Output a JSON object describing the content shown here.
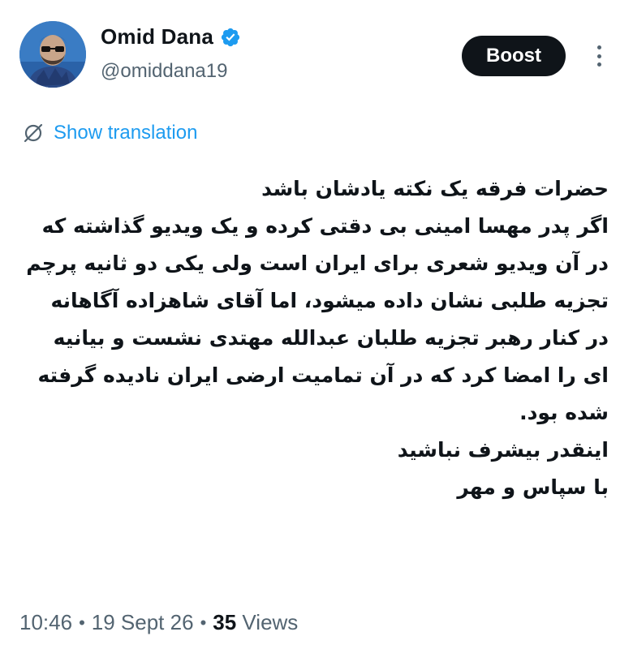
{
  "author": {
    "display_name": "Omid Dana",
    "handle": "@omiddana19",
    "verified": true,
    "verified_color": "#1d9bf0"
  },
  "actions": {
    "boost_label": "Boost"
  },
  "translation": {
    "label": "Show translation",
    "link_color": "#1d9bf0"
  },
  "tweet": {
    "lines": [
      "حضرات فرقه یک نکته یادشان باشد",
      "اگر پدر مهسا امینی بی دقتی کرده و یک ویدیو گذاشته که در آن ویدیو شعری برای ایران است ولی یکی دو ثانیه پرچم تجزیه طلبی نشان داده میشود، اما آقای شاهزاده آگاهانه در کنار رهبر تجزیه طلبان عبدالله مهتدی نشست و بیانیه ای را امضا کرد که در آن تمامیت ارضی ایران نادیده گرفته شده بود.",
      "اینقدر بیشرف نباشید",
      "با سپاس و مهر"
    ]
  },
  "meta": {
    "time": "10:46",
    "date": "19 Sept 26",
    "views_count": "35",
    "views_label": "Views"
  },
  "icons": {
    "verified": "verified-badge-icon",
    "more": "more-options-icon",
    "translate": "translate-icon"
  }
}
